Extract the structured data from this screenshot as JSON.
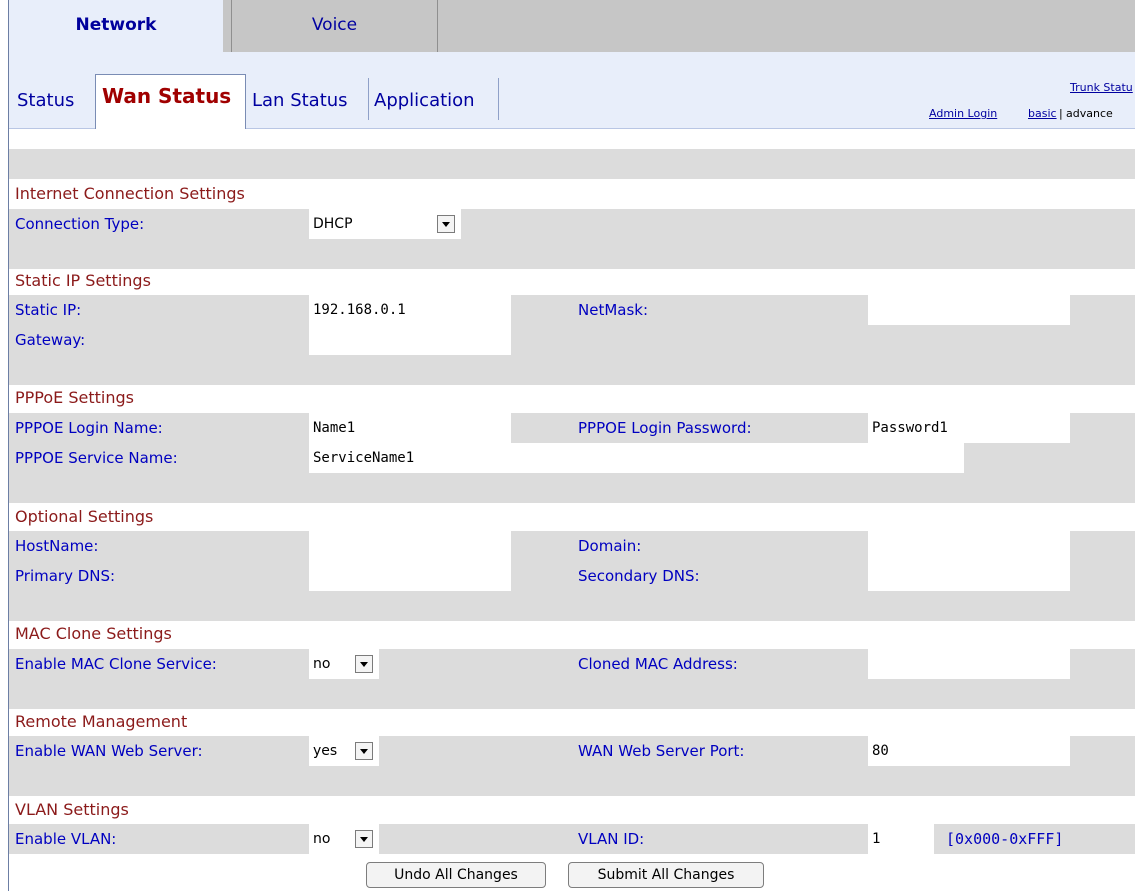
{
  "top_tabs": {
    "network": "Network",
    "voice": "Voice"
  },
  "sub_tabs": {
    "status": "Status",
    "wan_status": "Wan Status",
    "lan_status": "Lan Status",
    "application": "Application"
  },
  "links": {
    "trunk_status": "Trunk Statu",
    "admin_login": "Admin Login",
    "basic": "basic",
    "separator": "|",
    "advanced": "advance"
  },
  "sections": {
    "internet": {
      "title": "Internet Connection Settings",
      "connection_type_label": "Connection Type:",
      "connection_type_value": "DHCP"
    },
    "static_ip": {
      "title": "Static IP Settings",
      "static_ip_label": "Static IP:",
      "static_ip_value": "192.168.0.1",
      "netmask_label": "NetMask:",
      "netmask_value": "",
      "gateway_label": "Gateway:",
      "gateway_value": ""
    },
    "pppoe": {
      "title": "PPPoE Settings",
      "login_name_label": "PPPOE Login Name:",
      "login_name_value": "Name1",
      "login_password_label": "PPPOE Login Password:",
      "login_password_value": "Password1",
      "service_name_label": "PPPOE Service Name:",
      "service_name_value": "ServiceName1"
    },
    "optional": {
      "title": "Optional Settings",
      "hostname_label": "HostName:",
      "hostname_value": "",
      "domain_label": "Domain:",
      "domain_value": "",
      "primary_dns_label": "Primary DNS:",
      "primary_dns_value": "",
      "secondary_dns_label": "Secondary DNS:",
      "secondary_dns_value": ""
    },
    "mac_clone": {
      "title": "MAC Clone Settings",
      "enable_label": "Enable MAC Clone Service:",
      "enable_value": "no",
      "cloned_mac_label": "Cloned MAC Address:",
      "cloned_mac_value": ""
    },
    "remote": {
      "title": "Remote Management",
      "enable_wan_label": "Enable WAN Web Server:",
      "enable_wan_value": "yes",
      "port_label": "WAN Web Server Port:",
      "port_value": "80"
    },
    "vlan": {
      "title": "VLAN Settings",
      "enable_label": "Enable VLAN:",
      "enable_value": "no",
      "vlan_id_label": "VLAN ID:",
      "vlan_id_value": "1",
      "vlan_id_hint": "[0x000-0xFFF]"
    }
  },
  "buttons": {
    "undo": "Undo All Changes",
    "submit": "Submit All Changes"
  },
  "colors": {
    "label": "#0000c0",
    "section_title": "#8b1a1a",
    "band": "#dcdcdc",
    "tab_active_bg": "#e8eefa",
    "wan_tab_text": "#a00000"
  }
}
